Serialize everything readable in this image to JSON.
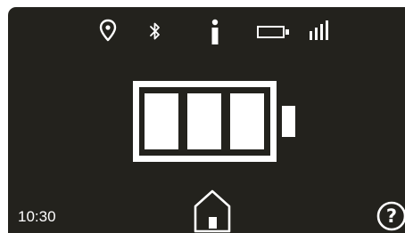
{
  "status_bar": {
    "icons": [
      "location-pin-icon",
      "bluetooth-icon",
      "info-icon",
      "battery-small-icon",
      "signal-strength-icon"
    ]
  },
  "battery": {
    "segments_total": 3,
    "segments_filled": 3,
    "level": 1.0
  },
  "footer": {
    "time": "10:30",
    "home_icon": "home-icon",
    "help_label": "?"
  },
  "colors": {
    "background": "#23221d",
    "foreground": "#ffffff"
  }
}
